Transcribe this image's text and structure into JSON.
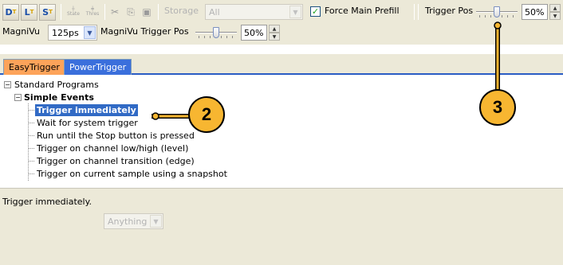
{
  "toolbar": {
    "trigger_buttons": [
      {
        "letter": "D",
        "sub": "T"
      },
      {
        "letter": "L",
        "sub": "T"
      },
      {
        "letter": "S",
        "sub": "T"
      }
    ],
    "state_icons": [
      "State",
      "Thres"
    ],
    "storage_label": "Storage",
    "storage_value": "All",
    "force_main_prefill_label": "Force Main Prefill",
    "force_main_prefill_checked": true,
    "trigger_pos_label": "Trigger Pos",
    "trigger_pos_value": "50%",
    "magnivu_label": "MagniVu",
    "magnivu_value": "125ps",
    "magnivu_trigger_pos_label": "MagniVu Trigger Pos",
    "magnivu_trigger_pos_value": "50%"
  },
  "tabs": [
    {
      "label": "EasyTrigger",
      "active": true
    },
    {
      "label": "PowerTrigger",
      "active": false
    }
  ],
  "tree": {
    "root": "Standard Programs",
    "group": "Simple Events",
    "items": [
      "Trigger immediately",
      "Wait for system trigger",
      "Run until the Stop button is pressed",
      "Trigger on channel low/high (level)",
      "Trigger on channel transition (edge)",
      "Trigger on current sample using a snapshot"
    ],
    "selected_index": 0
  },
  "description": {
    "text": "Trigger immediately.",
    "dropdown_value": "Anything"
  },
  "callouts": [
    "2",
    "3"
  ],
  "colors": {
    "selection": "#316ac5",
    "callout_fill": "#f7b631",
    "active_tab": "#fda35a",
    "inactive_tab": "#3a6fdc"
  }
}
